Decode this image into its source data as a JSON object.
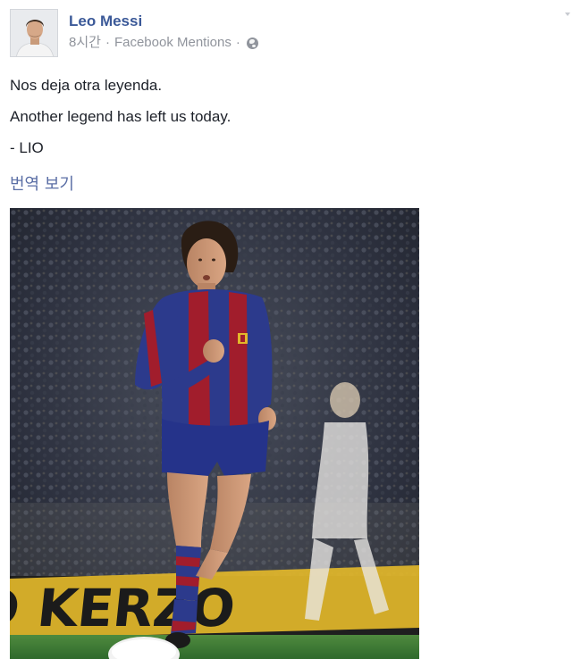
{
  "post": {
    "author": "Leo Messi",
    "time": "8시간",
    "separator": "·",
    "source": "Facebook Mentions",
    "privacy_icon": "globe-icon",
    "lines": [
      "Nos deja otra leyenda.",
      "Another legend has left us today.",
      "- LIO"
    ],
    "translate_label": "번역 보기",
    "photo_banner_text": "D KERZO"
  },
  "colors": {
    "author_link": "#3b5998",
    "meta_gray": "#90949c",
    "body_text": "#1d2129",
    "translate_link": "#5a6ea5",
    "jersey_blue": "#2c3a8c",
    "jersey_red": "#a11d2c",
    "pitch_green": "#3f7a36",
    "banner_yellow": "#e2b72a"
  }
}
